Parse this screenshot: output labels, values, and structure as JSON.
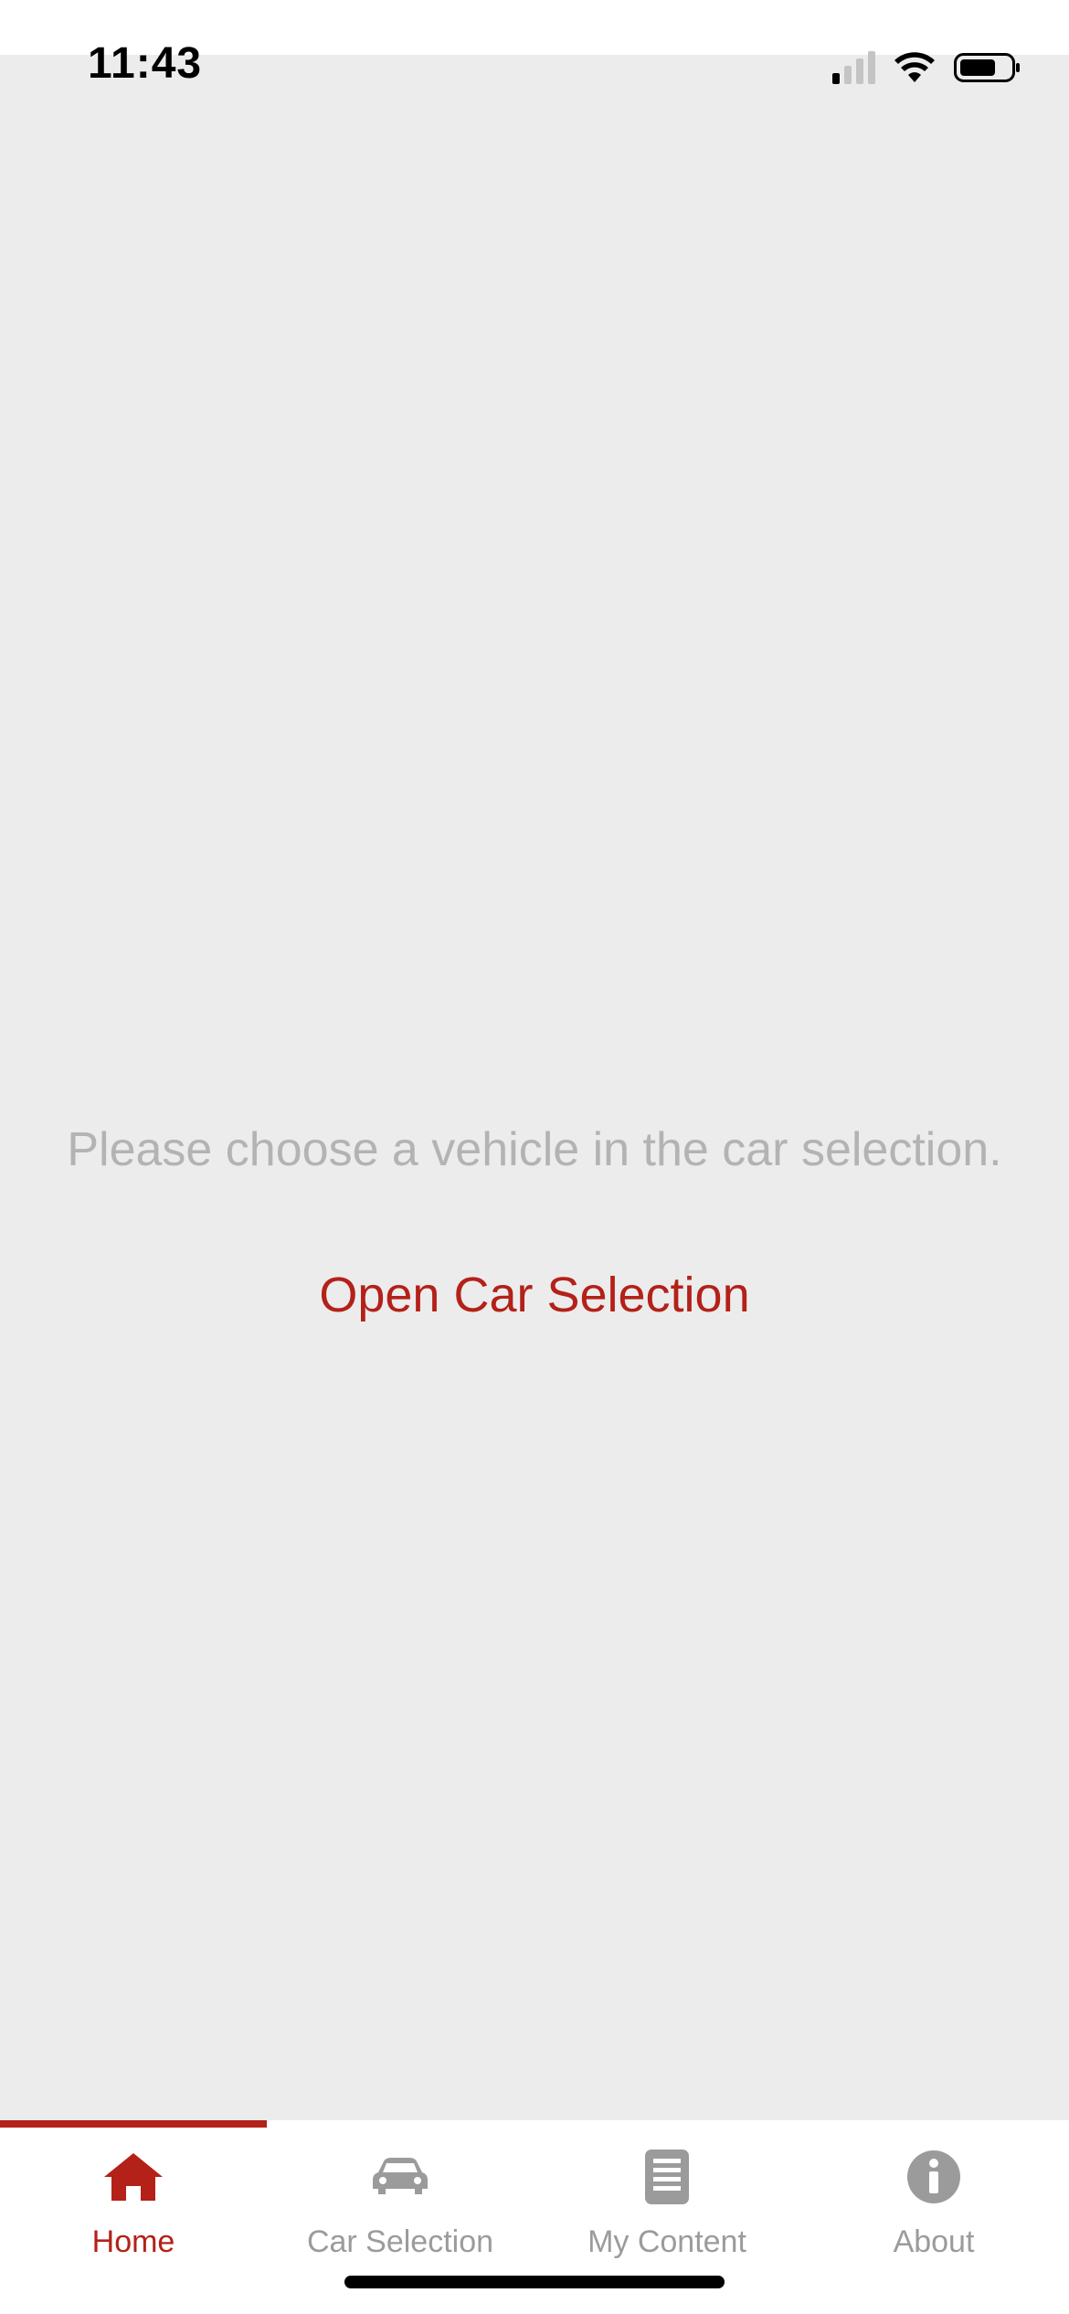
{
  "status_bar": {
    "time": "11:43",
    "signal_icon": "cellular-signal-icon",
    "wifi_icon": "wifi-icon",
    "battery_icon": "battery-icon",
    "signal_bars_active": 1,
    "signal_bars_total": 4
  },
  "main": {
    "empty_message": "Please choose a vehicle in the car selection.",
    "open_car_selection_label": "Open Car Selection"
  },
  "tabbar": {
    "active_index": 0,
    "tabs": [
      {
        "label": "Home",
        "icon": "home-icon"
      },
      {
        "label": "Car Selection",
        "icon": "car-icon"
      },
      {
        "label": "My Content",
        "icon": "document-list-icon"
      },
      {
        "label": "About",
        "icon": "info-icon"
      }
    ]
  },
  "colors": {
    "accent": "#b32118",
    "background": "#ececed",
    "inactive": "#9b9b9b",
    "message_text": "#b3b3b5"
  }
}
